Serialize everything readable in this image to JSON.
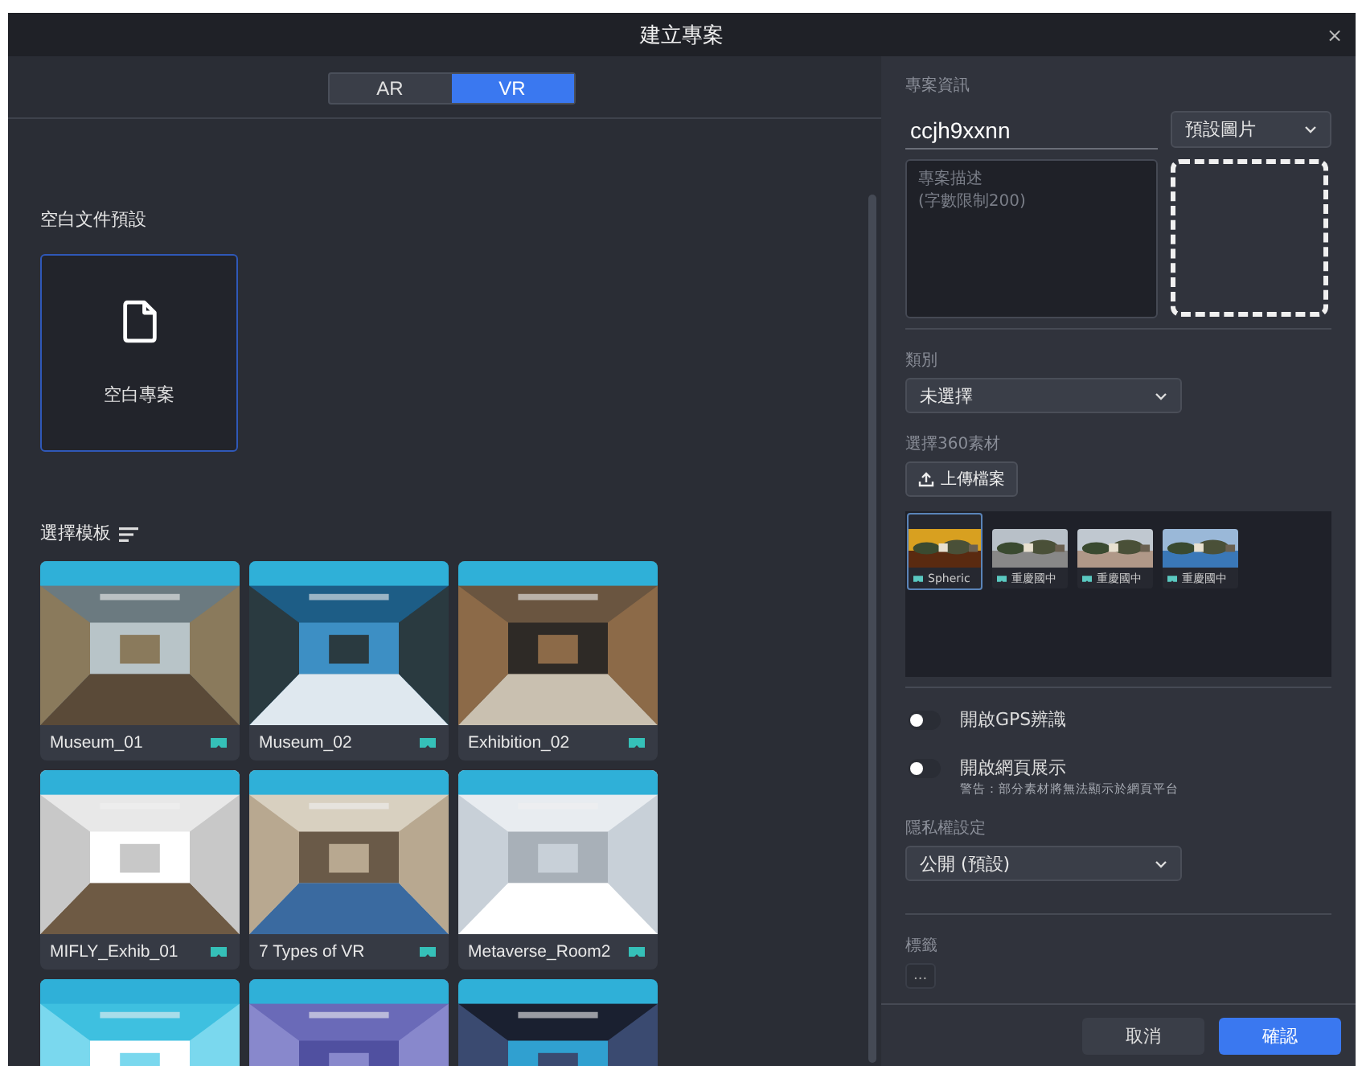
{
  "window": {
    "title": "建立專案",
    "close": "×"
  },
  "mode_tabs": [
    {
      "label": "AR",
      "selected": false
    },
    {
      "label": "VR",
      "selected": true
    }
  ],
  "blank_section": {
    "title": "空白文件預設",
    "card": {
      "label": "空白專案",
      "selected": true
    }
  },
  "template_section": {
    "title": "選擇模板",
    "templates": [
      {
        "kind": "card",
        "name": "Museum_01"
      },
      {
        "kind": "card",
        "name": "Museum_02"
      },
      {
        "kind": "card",
        "name": "Exhibition_02"
      },
      {
        "kind": "card",
        "name": "MIFLY_Exhib_01"
      },
      {
        "kind": "card",
        "name": "7 Types of VR"
      },
      {
        "kind": "card",
        "name": "Metaverse_Room2"
      },
      {
        "kind": "picture"
      },
      {
        "kind": "picture"
      },
      {
        "kind": "picture"
      }
    ]
  },
  "project_info": {
    "title": "專案資訊",
    "name_field": {
      "value": "ccjh9xxnn"
    },
    "cover_select": {
      "value": "預設圖片"
    },
    "description": {
      "placeholder": "專案描述\n(字數限制200)"
    }
  },
  "category": {
    "label": "類別",
    "value": "未選擇"
  },
  "media": {
    "label": "選擇360素材",
    "upload_button": "上傳檔案",
    "items": [
      {
        "name": "Spheric",
        "selected": true
      },
      {
        "name": "重慶國中",
        "selected": false
      },
      {
        "name": "重慶國中",
        "selected": false
      },
      {
        "name": "重慶國中",
        "selected": false
      }
    ]
  },
  "toggles": [
    {
      "label": "開啟GPS辨識",
      "on": false
    },
    {
      "label": "開啟網頁展示",
      "on": false,
      "note": "警告：部分素材將無法顯示於網頁平台"
    }
  ],
  "privacy": {
    "label": "隱私權設定",
    "value": "公開 (預設)"
  },
  "tags": {
    "label": "標籤",
    "items": [
      "..."
    ]
  },
  "buttons": [
    {
      "label": "取消",
      "kind": "secondary"
    },
    {
      "label": "確認",
      "kind": "primary"
    }
  ]
}
